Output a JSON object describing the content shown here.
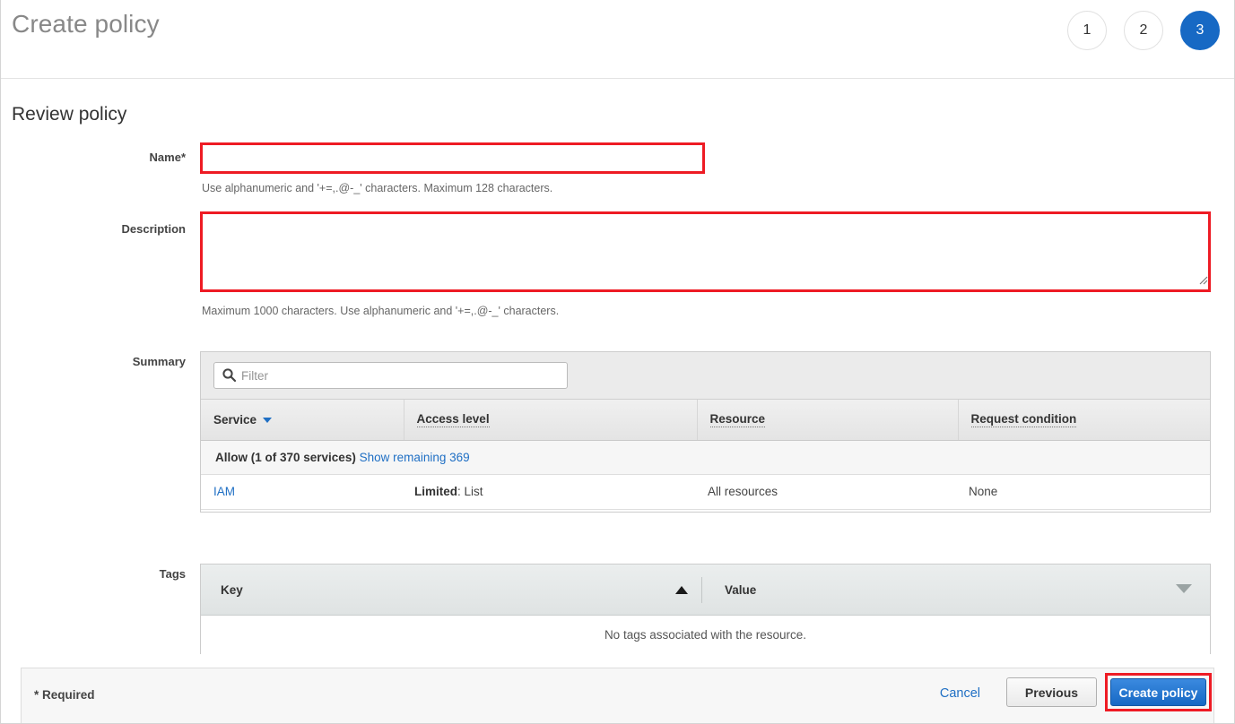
{
  "header": {
    "title": "Create policy",
    "steps": [
      {
        "label": "1",
        "state": "inactive"
      },
      {
        "label": "2",
        "state": "inactive"
      },
      {
        "label": "3",
        "state": "active"
      }
    ],
    "active_color": "#1769c4"
  },
  "section": {
    "heading": "Review policy"
  },
  "form": {
    "name": {
      "label": "Name*",
      "value": "",
      "placeholder": "",
      "hint": "Use alphanumeric and '+=,.@-_' characters. Maximum 128 characters.",
      "highlight_color": "#ee1b24"
    },
    "description": {
      "label": "Description",
      "value": "",
      "placeholder": "",
      "hint": "Maximum 1000 characters. Use alphanumeric and '+=,.@-_' characters.",
      "highlight_color": "#ee1b24"
    }
  },
  "summary": {
    "label": "Summary",
    "filter": {
      "value": "",
      "placeholder": "Filter",
      "icon": "search-icon"
    },
    "columns": [
      {
        "label": "Service",
        "sort": "descending",
        "sort_icon": "caret-down-icon",
        "dotted": false
      },
      {
        "label": "Access level",
        "dotted": true
      },
      {
        "label": "Resource",
        "dotted": true
      },
      {
        "label": "Request condition",
        "dotted": true
      }
    ],
    "group_row": {
      "label": "Allow (1 of 370 services)",
      "link": "Show remaining 369"
    },
    "rows": [
      {
        "service": "IAM",
        "access_level_prefix": "Limited",
        "access_level_value": ": List",
        "resource": "All resources",
        "request_condition": "None"
      }
    ]
  },
  "tags": {
    "label": "Tags",
    "columns": [
      {
        "label": "Key",
        "sort_icon": "caret-up-icon"
      },
      {
        "label": "Value",
        "sort_icon": "caret-down-outline-icon"
      }
    ],
    "empty_message": "No tags associated with the resource."
  },
  "footer": {
    "required_note": "* Required",
    "cancel_label": "Cancel",
    "previous_label": "Previous",
    "create_label": "Create policy",
    "highlight_color": "#ee1b24"
  }
}
